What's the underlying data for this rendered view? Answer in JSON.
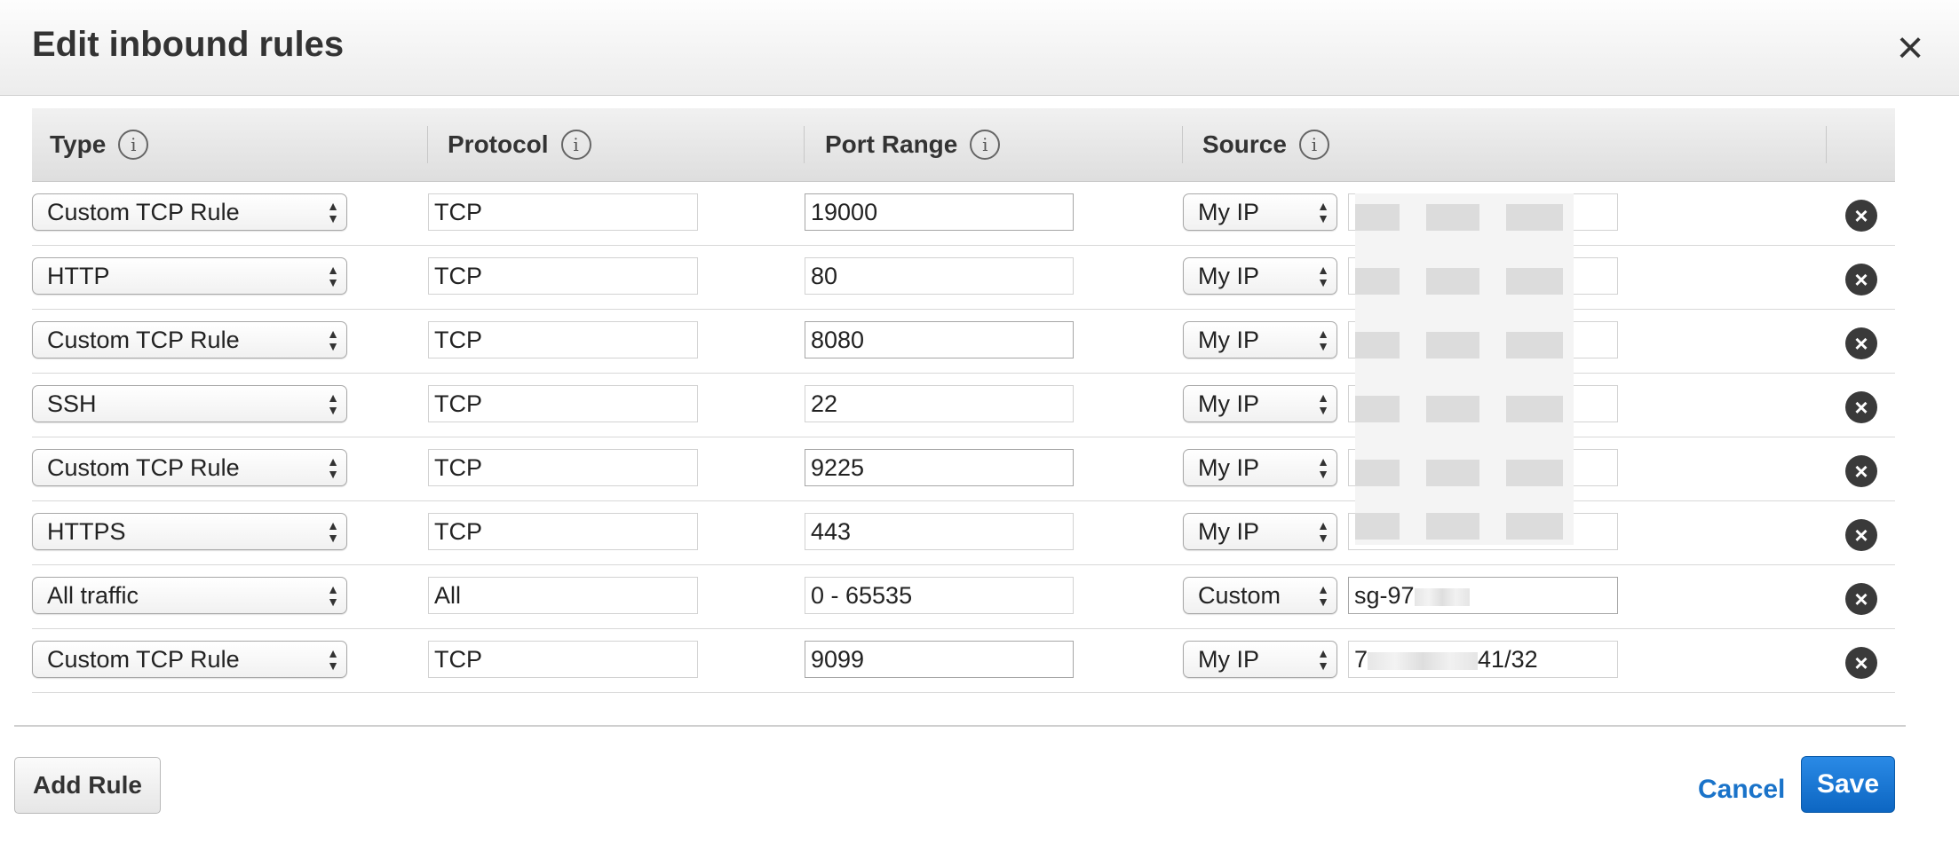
{
  "dialog": {
    "title": "Edit inbound rules",
    "close_symbol": "×",
    "close_icon": "close-icon"
  },
  "columns": {
    "type": "Type",
    "protocol": "Protocol",
    "port_range": "Port Range",
    "source": "Source",
    "info_glyph": "i"
  },
  "rules": [
    {
      "type": "Custom TCP Rule",
      "protocol": "TCP",
      "port_range": "19000",
      "source_type": "My IP",
      "source_value": ""
    },
    {
      "type": "HTTP",
      "protocol": "TCP",
      "port_range": "80",
      "source_type": "My IP",
      "source_value": ""
    },
    {
      "type": "Custom TCP Rule",
      "protocol": "TCP",
      "port_range": "8080",
      "source_type": "My IP",
      "source_value": ""
    },
    {
      "type": "SSH",
      "protocol": "TCP",
      "port_range": "22",
      "source_type": "My IP",
      "source_value": ""
    },
    {
      "type": "Custom TCP Rule",
      "protocol": "TCP",
      "port_range": "9225",
      "source_type": "My IP",
      "source_value": ""
    },
    {
      "type": "HTTPS",
      "protocol": "TCP",
      "port_range": "443",
      "source_type": "My IP",
      "source_value": ""
    },
    {
      "type": "All traffic",
      "protocol": "All",
      "port_range": "0 - 65535",
      "source_type": "Custom",
      "source_value_prefix": "sg-97",
      "source_value_suffix": ""
    },
    {
      "type": "Custom TCP Rule",
      "protocol": "TCP",
      "port_range": "9099",
      "source_type": "My IP",
      "source_value_prefix": "7",
      "source_value_suffix": "41/32"
    }
  ],
  "delete_symbol": "×",
  "select_arrows": {
    "up": "▲",
    "down": "▼"
  },
  "footer": {
    "add_rule": "Add Rule",
    "cancel": "Cancel",
    "save": "Save"
  },
  "colors": {
    "link": "#1a73c9",
    "primary": "#0d66c2"
  }
}
